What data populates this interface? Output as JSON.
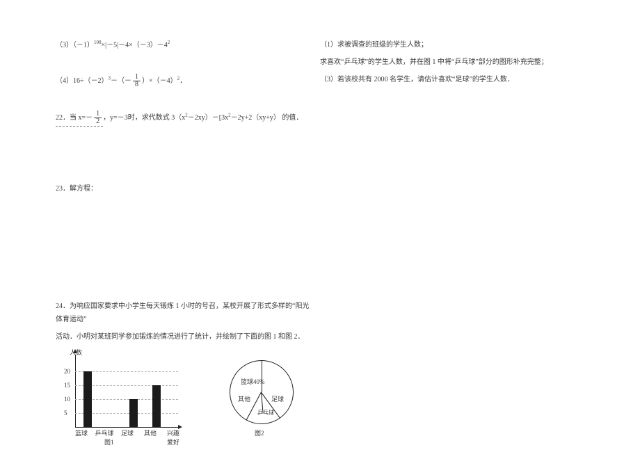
{
  "left": {
    "p3": "（3）（－1）",
    "p3_exp": "100",
    "p3_rest": "×|－5|－4×（－3）－4",
    "p3_exp2": "2",
    "p4_a": "（4）16÷（－2）",
    "p4_exp": "3",
    "p4_b": "－（－",
    "p4_frac_num": "1",
    "p4_frac_den": "8",
    "p4_c": "）×（－4）",
    "p4_exp2": "2",
    "p4_end": "．",
    "q22_a": "22．当 x=－",
    "q22_frac_num": "1",
    "q22_frac_den": "2",
    "q22_b": "，y=－3时，求代数式 3（x",
    "q22_e1": "2",
    "q22_c": "－2xy）－[3x",
    "q22_e2": "2",
    "q22_d": "－2y+2（xy+y） 的值．",
    "q23": "23．解方程：",
    "q24_a": "24．为响应国家要求中小学生每天锻炼 1 小时的号召，某校开展了形式多样的“阳光体育运动”",
    "q24_b": "活动．小明对某班同学参加锻炼的情况进行了统计，并绘制了下面的图 1 和图 2．"
  },
  "right": {
    "r1": "（1）求被调查的班级的学生人数；",
    "r2": "求喜欢“乒乓球”的学生人数，并在图 1 中将“乒乓球”部分的图形补充完整；",
    "r3": "（3）若该校共有 2000 名学生，请估计喜欢“足球”的学生人数．"
  },
  "fig1": {
    "ylabel": "人数",
    "ticks": {
      "t5": "5",
      "t10": "10",
      "t15": "15",
      "t20": "20"
    },
    "x": {
      "x1": "篮球",
      "x2": "乒乓球",
      "x3": "足球",
      "x4": "其他"
    },
    "xaxis": "兴趣爱好",
    "caption": "图1"
  },
  "fig2": {
    "basketball": "篮球40%",
    "other": "其他",
    "football": "足球",
    "pingpong": "乒乓球",
    "caption": "图2"
  },
  "chart_data": [
    {
      "type": "bar",
      "title": "图1",
      "xlabel": "兴趣爱好",
      "ylabel": "人数",
      "ylim": [
        0,
        20
      ],
      "categories": [
        "篮球",
        "乒乓球",
        "足球",
        "其他"
      ],
      "values": [
        20,
        null,
        10,
        15
      ],
      "note": "乒乓球 bar is missing and to be completed by the student"
    },
    {
      "type": "pie",
      "title": "图2",
      "slices": [
        {
          "label": "篮球",
          "percent": 40
        },
        {
          "label": "足球",
          "percent": null
        },
        {
          "label": "乒乓球",
          "percent": null
        },
        {
          "label": "其他",
          "percent": null
        }
      ],
      "note": "Only 篮球 percentage (40%) is labeled; remaining slice percentages are not given on the figure"
    }
  ]
}
